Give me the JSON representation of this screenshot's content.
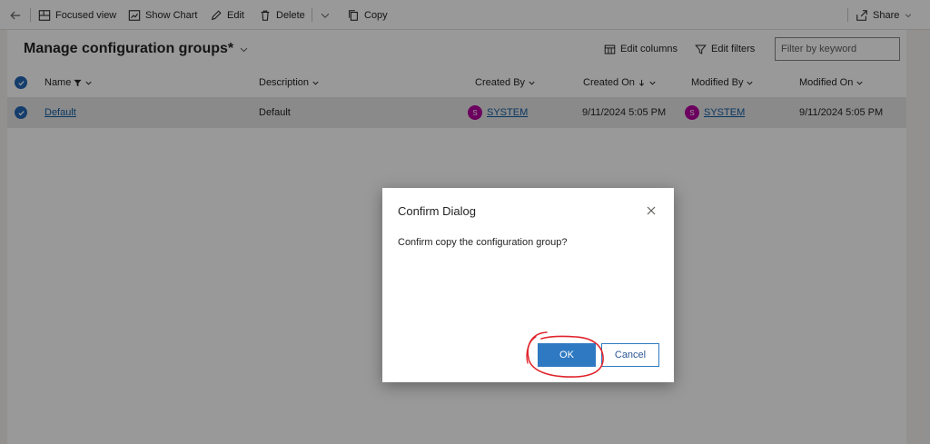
{
  "toolbar": {
    "focused_view": "Focused view",
    "show_chart": "Show Chart",
    "edit": "Edit",
    "delete": "Delete",
    "copy": "Copy",
    "share": "Share"
  },
  "view": {
    "title": "Manage configuration groups*",
    "edit_columns": "Edit columns",
    "edit_filters": "Edit filters",
    "keyword_placeholder": "Filter by keyword"
  },
  "grid": {
    "columns": {
      "name": "Name",
      "description": "Description",
      "created_by": "Created By",
      "created_on": "Created On",
      "modified_by": "Modified By",
      "modified_on": "Modified On"
    },
    "rows": [
      {
        "name": "Default",
        "description": "Default",
        "created_by": "SYSTEM",
        "created_by_initial": "S",
        "created_on": "9/11/2024 5:05 PM",
        "modified_by": "SYSTEM",
        "modified_by_initial": "S",
        "modified_on": "9/11/2024 5:05 PM"
      }
    ]
  },
  "dialog": {
    "title": "Confirm Dialog",
    "message": "Confirm copy the configuration group?",
    "ok": "OK",
    "cancel": "Cancel"
  },
  "colors": {
    "primary": "#2f79c2",
    "avatar": "#b4009e",
    "annotation": "#e0242c"
  }
}
